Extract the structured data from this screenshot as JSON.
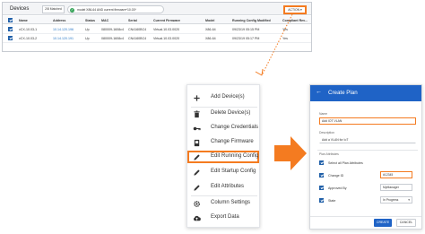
{
  "devices_panel": {
    "tab_label": "Devices",
    "matched_label": "2/8 Matched",
    "filter_check_icon": "check-icon",
    "filter_text": "model X86-64 AND current firmware^10.03*",
    "action_label": "ACTION ▾",
    "columns": [
      "Name",
      "Address",
      "Status",
      "MAC",
      "Serial",
      "Current Firmware",
      "Model",
      "Running Config Modified",
      "Compliant Rev..."
    ],
    "rows": [
      {
        "name": "vCX-10.03-1",
        "address": "10.14.120.196",
        "status": "Up",
        "mac": "080009-1608c4",
        "serial": "CN4160BC4",
        "firmware": "Virtual.10.03.0020",
        "model": "X86-64",
        "modified": "09/23/19 05:15 PM",
        "compliant": "Yes"
      },
      {
        "name": "vCX-10.03-2",
        "address": "10.14.120.191",
        "status": "Up",
        "mac": "080009-1608c4",
        "serial": "CN4160BC4",
        "firmware": "Virtual.10.03.0020",
        "model": "X86-64",
        "modified": "09/23/19 05:17 PM",
        "compliant": "Yes"
      }
    ]
  },
  "context_menu": {
    "items": [
      {
        "label": "Add Device(s)",
        "icon": "plus-icon"
      },
      {
        "label": "Delete Device(s)",
        "icon": "trash-icon"
      },
      {
        "label": "Change Credentials",
        "icon": "key-icon"
      },
      {
        "label": "Change Firmware",
        "icon": "chip-icon"
      },
      {
        "label": "Edit Running Config",
        "icon": "pencil-icon"
      },
      {
        "label": "Edit Startup Config",
        "icon": "pencil-icon"
      },
      {
        "label": "Edit Attributes",
        "icon": "pencil-icon"
      },
      {
        "label": "Column Settings",
        "icon": "gear-icon"
      },
      {
        "label": "Export Data",
        "icon": "cloud-upload-icon"
      }
    ],
    "highlighted_index": 4
  },
  "create_plan": {
    "title": "Create Plan",
    "back_icon": "arrow-left-icon",
    "name_label": "Name",
    "name_value": "Add IOT VLAN",
    "description_label": "Description",
    "description_value": "Add a VLAN for IoT",
    "attributes_label": "Plan Attributes",
    "select_all_label": "Select all Plan Attributes",
    "attributes": [
      {
        "label": "Change ID",
        "value": "#12345"
      },
      {
        "label": "Approved By",
        "value": "MyManager"
      },
      {
        "label": "State",
        "value": "In Progress"
      }
    ],
    "create_label": "CREATE",
    "cancel_label": "CANCEL"
  },
  "colors": {
    "accent_orange": "#f47b20",
    "primary_blue": "#1f63c6",
    "link_blue": "#2a78c6",
    "status_green": "#3aa55c"
  }
}
